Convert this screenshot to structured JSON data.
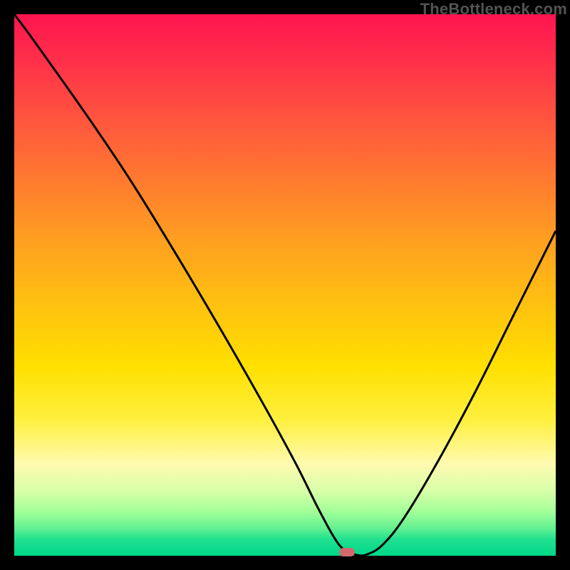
{
  "watermark": {
    "text": "TheBottleneck.com"
  },
  "colors": {
    "curve_stroke": "#000000",
    "marker_fill": "#d06a6e",
    "frame_bg": "#000000"
  },
  "chart_data": {
    "type": "line",
    "title": "",
    "xlabel": "",
    "ylabel": "",
    "xlim": [
      0,
      100
    ],
    "ylim": [
      0,
      100
    ],
    "grid": false,
    "series": [
      {
        "name": "bottleneck-curve",
        "x": [
          0,
          3,
          8,
          15,
          22,
          30,
          38,
          46,
          52,
          56,
          59,
          61,
          63,
          65,
          68,
          72,
          78,
          85,
          92,
          100
        ],
        "values": [
          100,
          96,
          89,
          79,
          68.5,
          55.5,
          42,
          28,
          17,
          9,
          3.5,
          1,
          0.2,
          0.2,
          2,
          7,
          17,
          30,
          44,
          60
        ]
      }
    ],
    "markers": [
      {
        "name": "optimal-point",
        "x": 61.5,
        "y": 0.6
      }
    ]
  }
}
